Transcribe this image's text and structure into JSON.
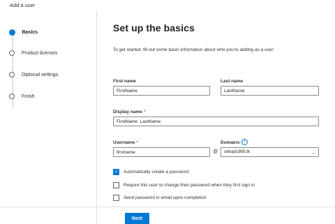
{
  "window": {
    "title": "Add a user"
  },
  "steps": [
    {
      "label": "Basics",
      "active": true
    },
    {
      "label": "Product licenses",
      "active": false
    },
    {
      "label": "Optional settings",
      "active": false
    },
    {
      "label": "Finish",
      "active": false
    }
  ],
  "main": {
    "heading": "Set up the basics",
    "intro": "To get started, fill out some basic information about who you're adding as a user."
  },
  "form": {
    "first_name": {
      "label": "First name",
      "value": "FirstName"
    },
    "last_name": {
      "label": "Last name",
      "value": "LastName"
    },
    "display_name": {
      "label": "Display name",
      "required_mark": "*",
      "value": "FirstName  LastName"
    },
    "username": {
      "label": "Username",
      "required_mark": "*",
      "value": "firstname"
    },
    "at_sign": "@",
    "domains": {
      "label": "Domains",
      "info_icon": "info-icon",
      "value": "setupo365.tk",
      "chevron_icon": "chevron-down-icon"
    }
  },
  "options": [
    {
      "label": "Automatically create a password",
      "checked": true
    },
    {
      "label": "Require this user to change their password when they first sign in",
      "checked": false
    },
    {
      "label": "Send password in email upon completion",
      "checked": false
    }
  ],
  "footer": {
    "next_label": "Next"
  },
  "colors": {
    "accent": "#0078d4",
    "required": "#a4262c",
    "border": "#8a8886"
  }
}
